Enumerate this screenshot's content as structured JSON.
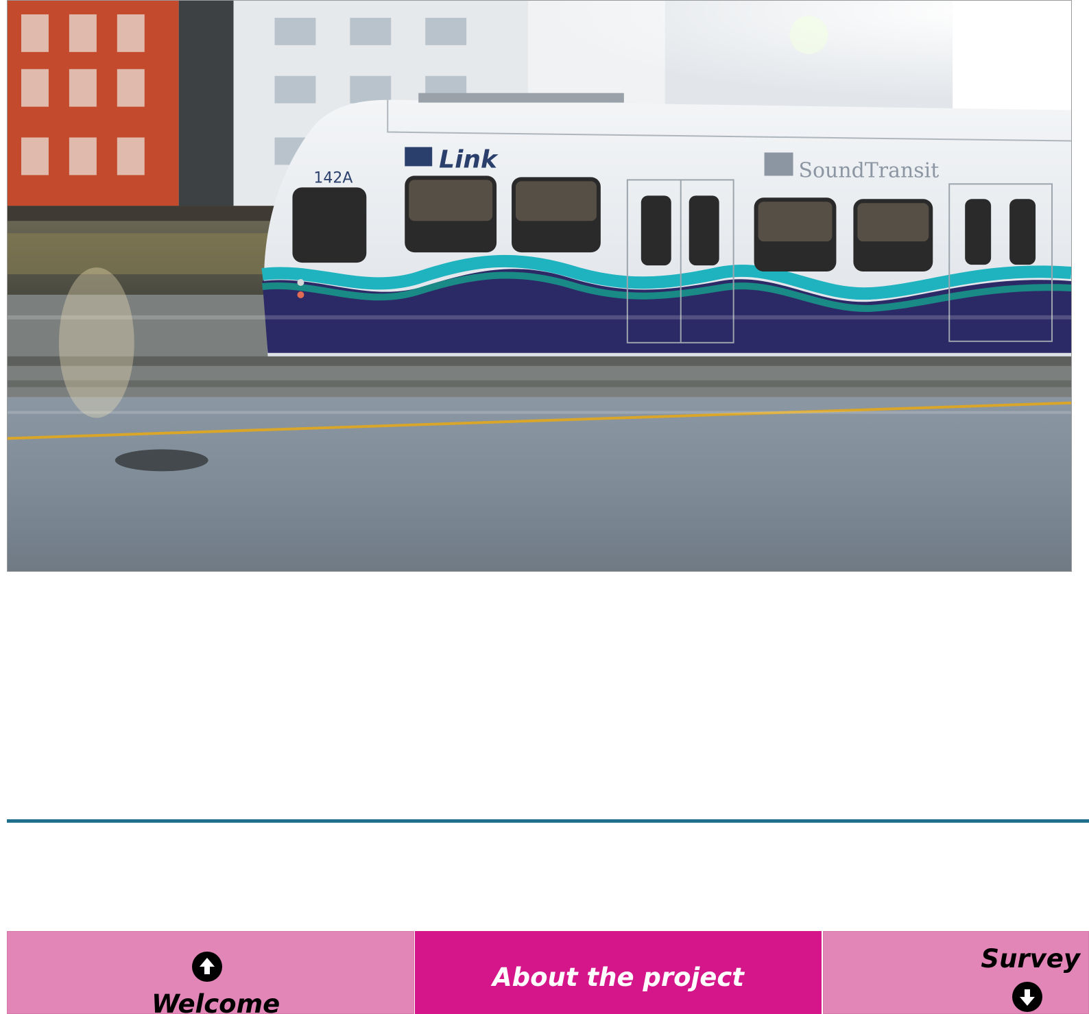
{
  "hero": {
    "image_label": "Link light rail train photo",
    "train_number": "142A",
    "link_logo_text": "Link",
    "sound_transit_text": "SoundTransit"
  },
  "navigation": {
    "previous": {
      "label": "Welcome",
      "icon": "arrow-up-circle-icon"
    },
    "current": {
      "label": "About the project"
    },
    "next": {
      "label": "Survey",
      "icon": "arrow-down-circle-icon"
    }
  },
  "colors": {
    "divider": "#1f6e8c",
    "card_inactive": "#e286b8",
    "card_active": "#d5168a",
    "train_teal": "#1fb3c0",
    "train_navy": "#2c2a66"
  }
}
